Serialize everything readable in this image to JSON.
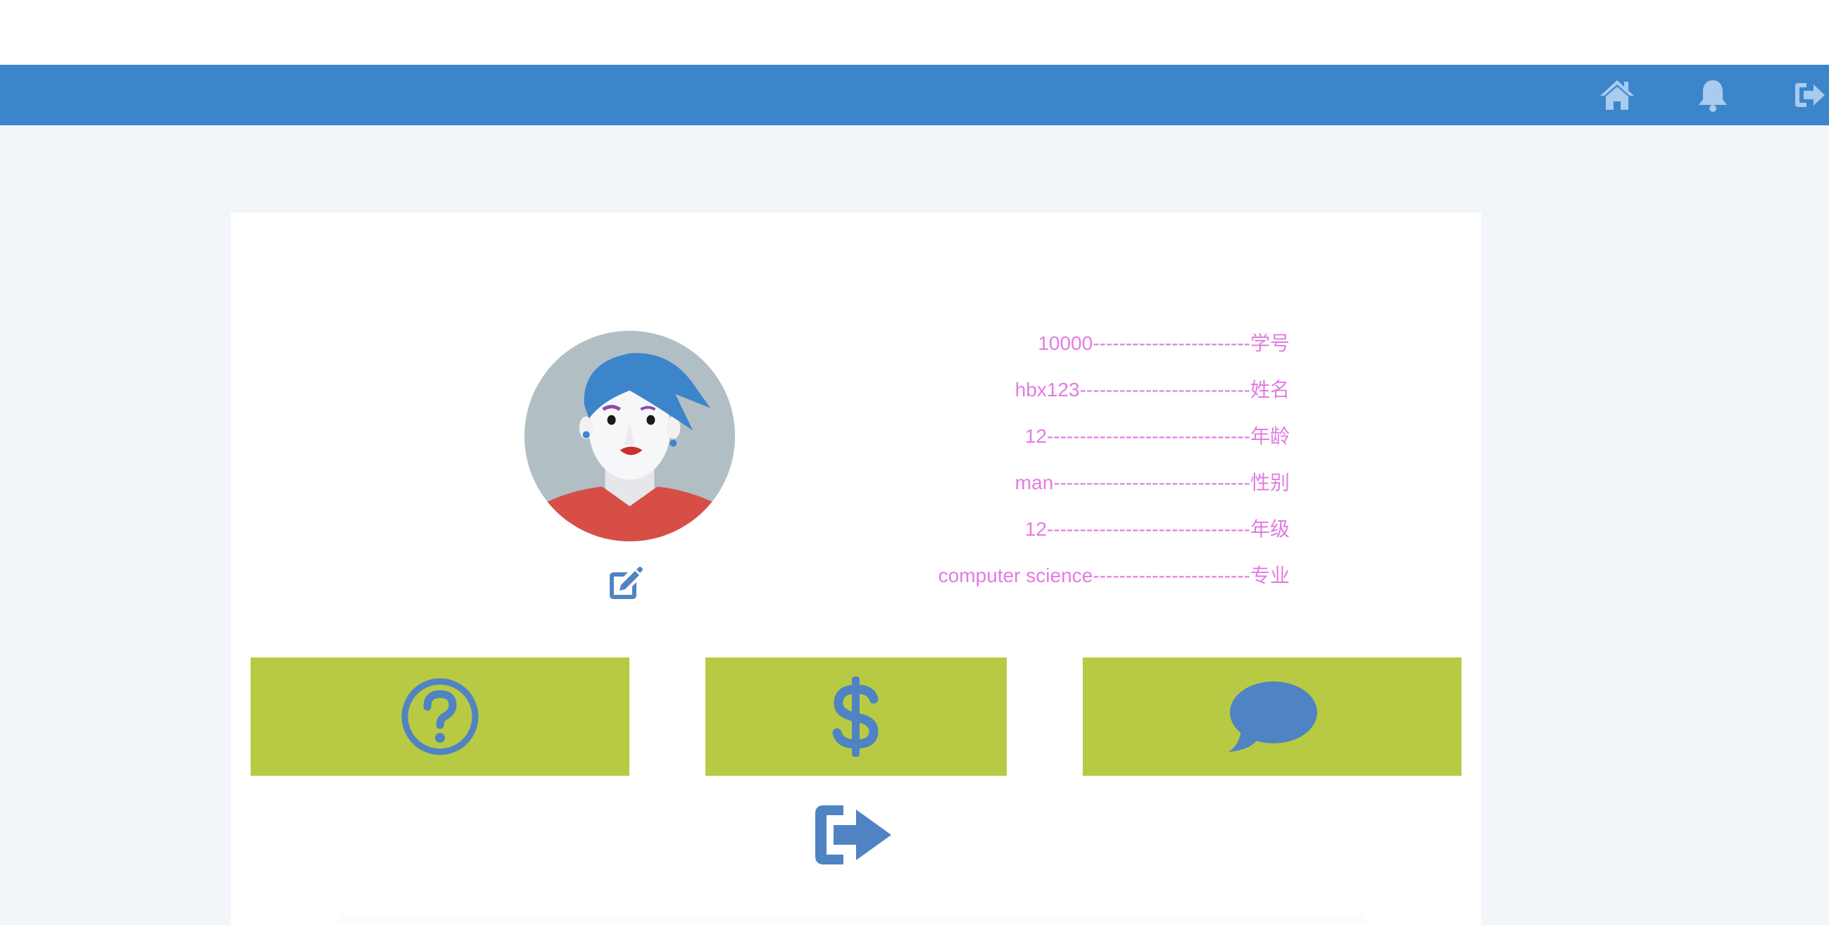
{
  "header": {
    "colors": {
      "bar": "#3d85cb",
      "icon": "#a9cbee"
    },
    "icons": [
      "home-icon",
      "bell-icon",
      "sign-out-icon"
    ]
  },
  "profile": {
    "avatar": "avatar-illustration",
    "edit_icon": "edit-icon",
    "fields": [
      {
        "text": "10000------------------------学号"
      },
      {
        "text": "hbx123--------------------------姓名"
      },
      {
        "text": "12-------------------------------年龄"
      },
      {
        "text": "man------------------------------性别"
      },
      {
        "text": "12-------------------------------年级"
      },
      {
        "text": "computer science------------------------专业"
      }
    ],
    "text_color": "#e27ce2"
  },
  "actions": {
    "tile_color": "#b8ca44",
    "icon_color": "#4f83c4",
    "tiles": [
      {
        "icon": "question-circle-icon"
      },
      {
        "icon": "dollar-icon"
      },
      {
        "icon": "comment-icon"
      }
    ],
    "logout_icon": "sign-out-icon"
  }
}
